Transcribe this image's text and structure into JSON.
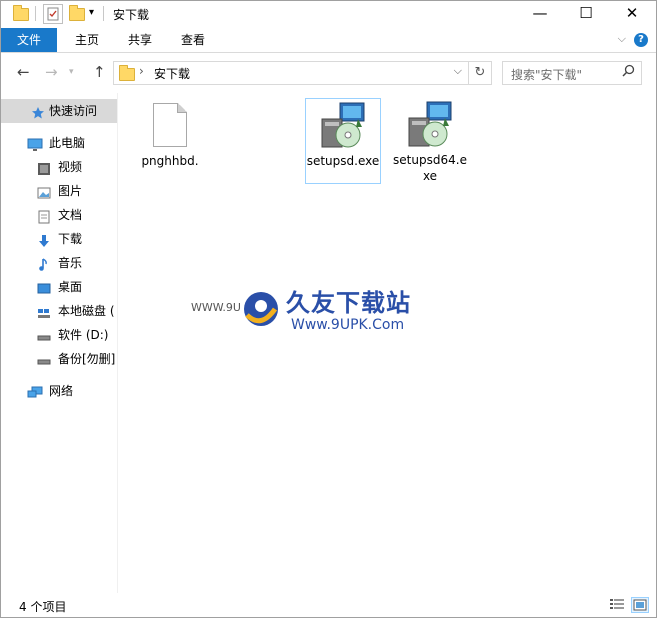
{
  "window": {
    "title": "安下载",
    "minimize_glyph": "—",
    "maximize_glyph": "☐",
    "close_glyph": "✕"
  },
  "ribbon": {
    "tabs": [
      {
        "label": "文件"
      },
      {
        "label": "主页"
      },
      {
        "label": "共享"
      },
      {
        "label": "查看"
      }
    ],
    "help_glyph": "?",
    "collapse_glyph": "⌵"
  },
  "navigation": {
    "back_glyph": "←",
    "forward_glyph": "→",
    "up_glyph": "↑",
    "breadcrumb_sep": "›",
    "address": "安下载",
    "refresh_glyph": "↻",
    "search_placeholder": "搜索\"安下载\"",
    "search_glyph": "⚲"
  },
  "sidebar": {
    "items": [
      {
        "label": "快速访问",
        "icon": "star-icon"
      },
      {
        "label": "此电脑",
        "icon": "computer-icon"
      },
      {
        "label": "视频",
        "icon": "video-icon"
      },
      {
        "label": "图片",
        "icon": "picture-icon"
      },
      {
        "label": "文档",
        "icon": "document-icon"
      },
      {
        "label": "下载",
        "icon": "download-icon"
      },
      {
        "label": "音乐",
        "icon": "music-icon"
      },
      {
        "label": "桌面",
        "icon": "desktop-icon"
      },
      {
        "label": "本地磁盘 (",
        "icon": "disk-icon"
      },
      {
        "label": "软件 (D:)",
        "icon": "drive-icon"
      },
      {
        "label": "备份[勿删]",
        "icon": "drive-icon"
      },
      {
        "label": "网络",
        "icon": "network-icon"
      }
    ]
  },
  "files": [
    {
      "name": "pnghhbd.",
      "icon": "blank-file-icon",
      "selected": false
    },
    {
      "name": "setupsd.exe",
      "icon": "installer-icon",
      "selected": true
    },
    {
      "name": "setupsd64.exe",
      "icon": "installer-icon",
      "selected": false
    }
  ],
  "watermark": {
    "prefix": "WWW.9U",
    "title": "久友下载站",
    "url": "Www.9UPK.Com"
  },
  "status": {
    "item_count": "4 个项目"
  },
  "colors": {
    "accent": "#1979ca",
    "selection_border": "#99d1ff",
    "nav_selected": "#d9d9d9"
  }
}
